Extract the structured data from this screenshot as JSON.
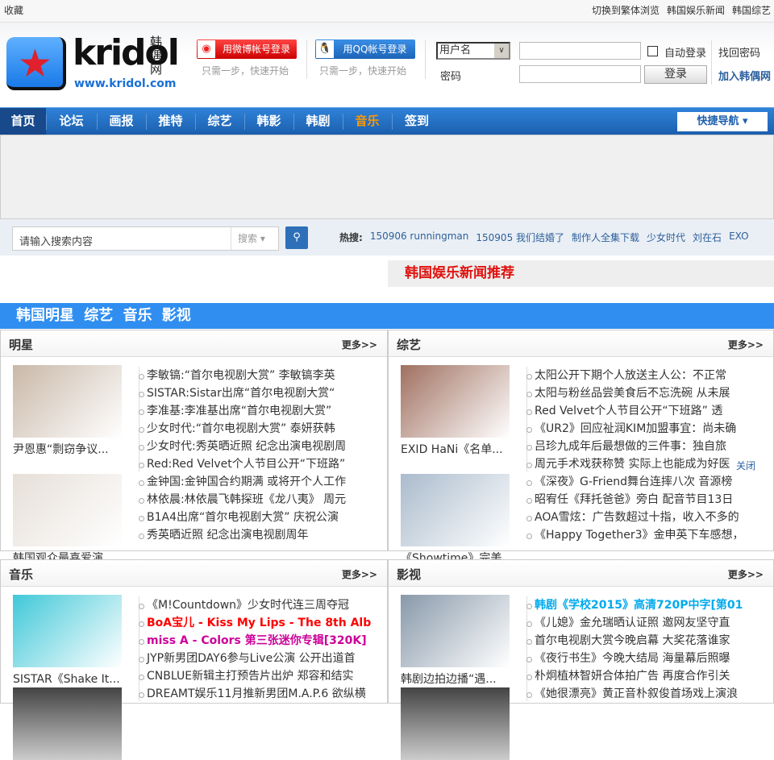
{
  "topbar": {
    "left": "收藏",
    "links": [
      "切换到繁体浏览",
      "韩国娱乐新闻",
      "韩国综艺"
    ]
  },
  "logo": {
    "text": "kridol",
    "cn": "韩偶网",
    "url": "www.kridol.com"
  },
  "social": {
    "weibo": "用微博帐号登录",
    "qq": "用QQ帐号登录",
    "hint": "只需一步，快速开始"
  },
  "login": {
    "select": "用户名",
    "password_label": "密码",
    "auto": "自动登录",
    "submit": "登录",
    "forgot": "找回密码",
    "join": "加入韩偶网"
  },
  "nav": {
    "items": [
      "首页",
      "论坛",
      "画报",
      "推特",
      "综艺",
      "韩影",
      "韩剧",
      "音乐",
      "签到"
    ],
    "quick": "快捷导航",
    "highlight": "#ff9900"
  },
  "search": {
    "placeholder": "请输入搜索内容",
    "type": "搜索",
    "hot_label": "热搜:",
    "hot": [
      "150906 runningman",
      "150905 我们结婚了",
      "制作人全集下载",
      "少女时代",
      "刘在石",
      "EXO"
    ]
  },
  "recommend": "韩国娱乐新闻推荐",
  "categories": "韩国明星 综艺 音乐 影视",
  "more": "更多>>",
  "close": "关闭",
  "panels": [
    {
      "title": "明星",
      "thumbs": [
        "尹恩惠“剽窃争议...",
        "韩国观众最喜爱演..."
      ],
      "items": [
        "李敏镐:“首尔电视剧大赏” 李敏镐李英",
        "SISTAR:Sistar出席“首尔电视剧大赏“",
        "李准基:李准基出席“首尔电视剧大赏”",
        "少女时代:“首尔电视剧大赏” 泰妍获韩",
        "少女时代:秀英晒近照 纪念出演电视剧周",
        "Red:Red Velvet个人节目公开“下班路”",
        "金钟国:金钟国合约期满 或将开个人工作",
        "林依晨:林依晨飞韩探班《龙八夷》 周元",
        "B1A4出席“首尔电视剧大赏” 庆祝公演",
        "秀英晒近照 纪念出演电视剧周年"
      ]
    },
    {
      "title": "综艺",
      "thumbs": [
        "EXID HaNi《名单...",
        "《Showtime》完美..."
      ],
      "items": [
        "太阳公开下期个人放送主人公：不正常",
        "太阳与粉丝品尝美食后不忘洗碗 从未展",
        "Red Velvet个人节目公开“下班路” 透",
        "《UR2》回应祉润KIM加盟事宜：尚未确",
        "吕珍九成年后最想做的三件事：独自旅",
        "周元手术戏获称赞 实际上也能成为好医",
        "《深夜》G-Friend舞台连摔八次 音源榜",
        "昭宥任《拜托爸爸》旁白 配音节目13日",
        "AOA雪炫：广告数超过十指，收入不多的",
        "《Happy Together3》金申英下车感想，"
      ]
    },
    {
      "title": "音乐",
      "thumbs": [
        "SISTAR《Shake It..."
      ],
      "items": [
        "《M!Countdown》少女时代连三周夺冠",
        "BoA宝儿 - Kiss My Lips - The 8th Alb",
        "miss A - Colors 第三张迷你专辑[320K]",
        "JYP新男团DAY6参与Live公演 公开出道首",
        "CNBLUE新辑主打预告片出炉 郑容和结实",
        "DREAMT娱乐11月推新男团M.A.P.6 欲纵横"
      ],
      "item_colors": [
        "",
        "#ff0000",
        "#cc0099",
        "",
        "",
        ""
      ]
    },
    {
      "title": "影视",
      "thumbs": [
        "韩剧边拍边播“遇..."
      ],
      "items": [
        "韩剧《学校2015》高清720P中字[第01",
        "《儿媳》金允瑞晒认证照 邀网友坚守直",
        "首尔电视剧大赏今晚启幕 大奖花落谁家",
        "《夜行书生》今晚大结局 海量幕后照曝",
        "朴炯植林智妍合体拍广告 再度合作引关",
        "《她很漂亮》黄正音朴叙俊首场戏上演浪"
      ],
      "item_colors": [
        "#00aaee",
        "",
        "",
        "",
        "",
        ""
      ]
    }
  ]
}
